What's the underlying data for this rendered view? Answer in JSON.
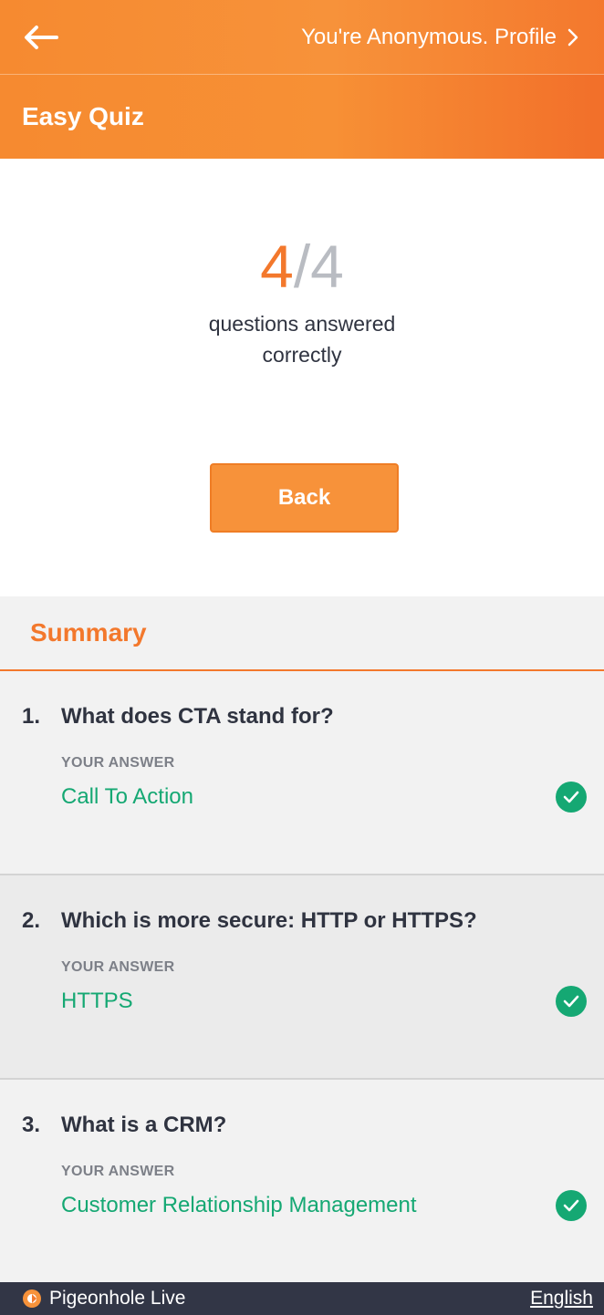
{
  "header": {
    "profile_text": "You're Anonymous. Profile",
    "title": "Easy Quiz"
  },
  "result": {
    "correct": "4",
    "separator": "/",
    "total": "4",
    "caption_line1": "questions answered",
    "caption_line2": "correctly",
    "back_label": "Back"
  },
  "summary": {
    "title": "Summary",
    "answer_label": "YOUR ANSWER",
    "questions": [
      {
        "number": "1.",
        "question": "What does CTA stand for?",
        "answer": "Call To Action"
      },
      {
        "number": "2.",
        "question": "Which is more secure: HTTP or HTTPS?",
        "answer": "HTTPS"
      },
      {
        "number": "3.",
        "question": "What is a CRM?",
        "answer": "Customer Relationship Management"
      }
    ]
  },
  "footer": {
    "brand": "Pigeonhole Live",
    "language": "English"
  },
  "colors": {
    "accent": "#f3782c",
    "correct": "#15a873",
    "footer_bg": "#323646"
  },
  "icons": {
    "back": "arrow-left-icon",
    "profile": "chevron-right-icon",
    "correct": "check-circle-icon",
    "brand": "pigeonhole-logo-icon"
  }
}
